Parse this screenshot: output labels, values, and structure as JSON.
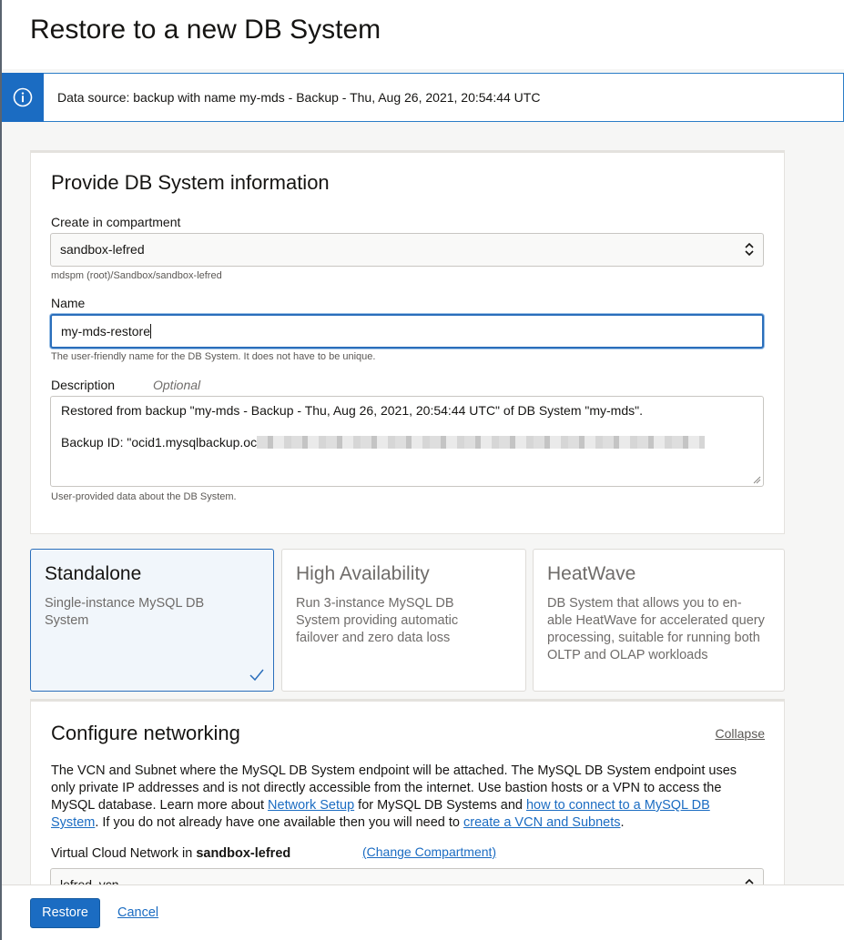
{
  "page_title": "Restore to a new DB System",
  "banner": {
    "text": "Data source: backup with name my-mds - Backup - Thu, Aug 26, 2021, 20:54:44 UTC"
  },
  "info_section": {
    "title": "Provide DB System information",
    "compartment": {
      "label": "Create in compartment",
      "value": "sandbox-lefred",
      "path": "mdspm (root)/Sandbox/sandbox-lefred"
    },
    "name": {
      "label": "Name",
      "value": "my-mds-restore",
      "helper": "The user-friendly name for the DB System. It does not have to be unique."
    },
    "description": {
      "label": "Description",
      "optional": "Optional",
      "line1": "Restored from backup \"my-mds - Backup - Thu, Aug 26, 2021, 20:54:44 UTC\" of DB System \"my-mds\".",
      "line2": "Backup ID: \"ocid1.mysqlbackup.oc",
      "helper": "User-provided data about the DB System."
    }
  },
  "system_types": [
    {
      "title": "Standalone",
      "description": "Single-instance MySQL DB System",
      "selected": true
    },
    {
      "title": "High Availability",
      "description": "Run 3-instance MySQL DB System providing automatic failover and zero data loss",
      "selected": false
    },
    {
      "title": "HeatWave",
      "description": "DB System that allows you to en-able HeatWave for accelerated query processing, suitable for running both OLTP and OLAP workloads",
      "selected": false
    }
  ],
  "networking": {
    "title": "Configure networking",
    "collapse_label": "Collapse",
    "para_1": "The VCN and Subnet where the MySQL DB System endpoint will be attached. The MySQL DB System endpoint uses only private IP addresses and is not directly accessible from the internet. Use bastion hosts or a VPN to access the MySQL database. Learn more about ",
    "link_network_setup": "Network Setup",
    "para_2": " for MySQL DB Systems and ",
    "link_connect": "how to connect to a MySQL DB System",
    "para_3": ". If you do not already have one available then you will need to ",
    "link_create_vcn": "create a VCN and Subnets",
    "para_4": ".",
    "vcn_label": "Virtual Cloud Network in ",
    "vcn_compartment": "sandbox-lefred",
    "change_compartment": "(Change Compartment)",
    "vcn_value": "lefred_vcn"
  },
  "footer": {
    "restore_label": "Restore",
    "cancel_label": "Cancel"
  },
  "colors": {
    "accent": "#1b6cc2",
    "selected_border": "#2a6ebb"
  }
}
